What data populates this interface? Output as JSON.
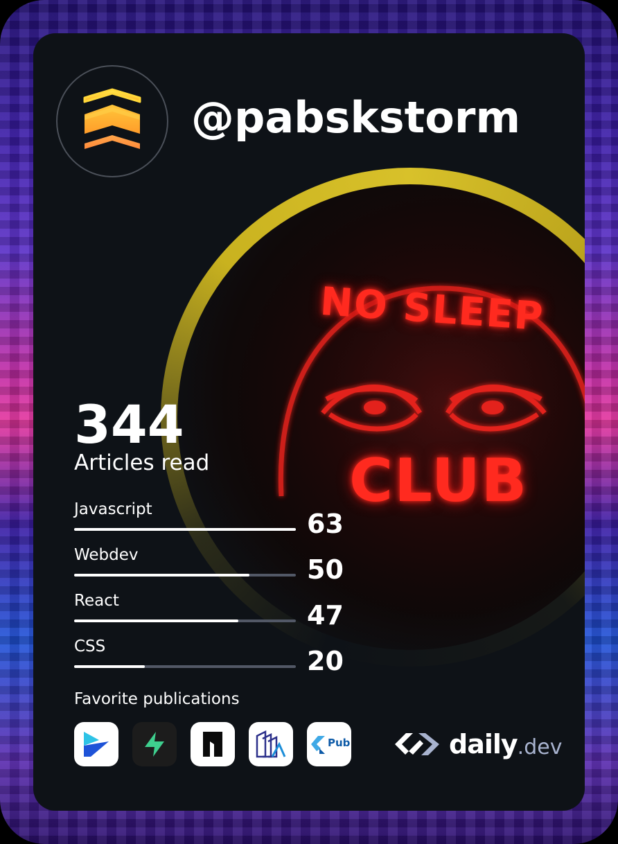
{
  "profile": {
    "username": "@pabskstorm",
    "avatar_icon": "rank-chevrons-icon"
  },
  "cover": {
    "sign_lines": [
      "NO SLEEP",
      "CLUB"
    ],
    "ring_color": "#c9b21f",
    "neon_color": "#e0201a"
  },
  "stats": {
    "articles_count": "344",
    "articles_label": "Articles read"
  },
  "tags": [
    {
      "name": "Javascript",
      "value": "63",
      "fraction": 1.0
    },
    {
      "name": "Webdev",
      "value": "50",
      "fraction": 0.79
    },
    {
      "name": "React",
      "value": "47",
      "fraction": 0.74
    },
    {
      "name": "CSS",
      "value": "20",
      "fraction": 0.32
    }
  ],
  "publications": {
    "title": "Favorite publications",
    "items": [
      {
        "icon": "publication-arrow-icon",
        "bg": "#ffffff"
      },
      {
        "icon": "supabase-bolt-icon",
        "bg": "#1c1c1c"
      },
      {
        "icon": "publication-notch-icon",
        "bg": "#ffffff"
      },
      {
        "icon": "publication-stack-icon",
        "bg": "#ffffff"
      },
      {
        "icon": "flutter-pub-icon",
        "bg": "#ffffff",
        "text": "Pub"
      }
    ]
  },
  "brand": {
    "word": "daily",
    "ext": ".dev",
    "icon": "daily-dev-logo-icon"
  }
}
